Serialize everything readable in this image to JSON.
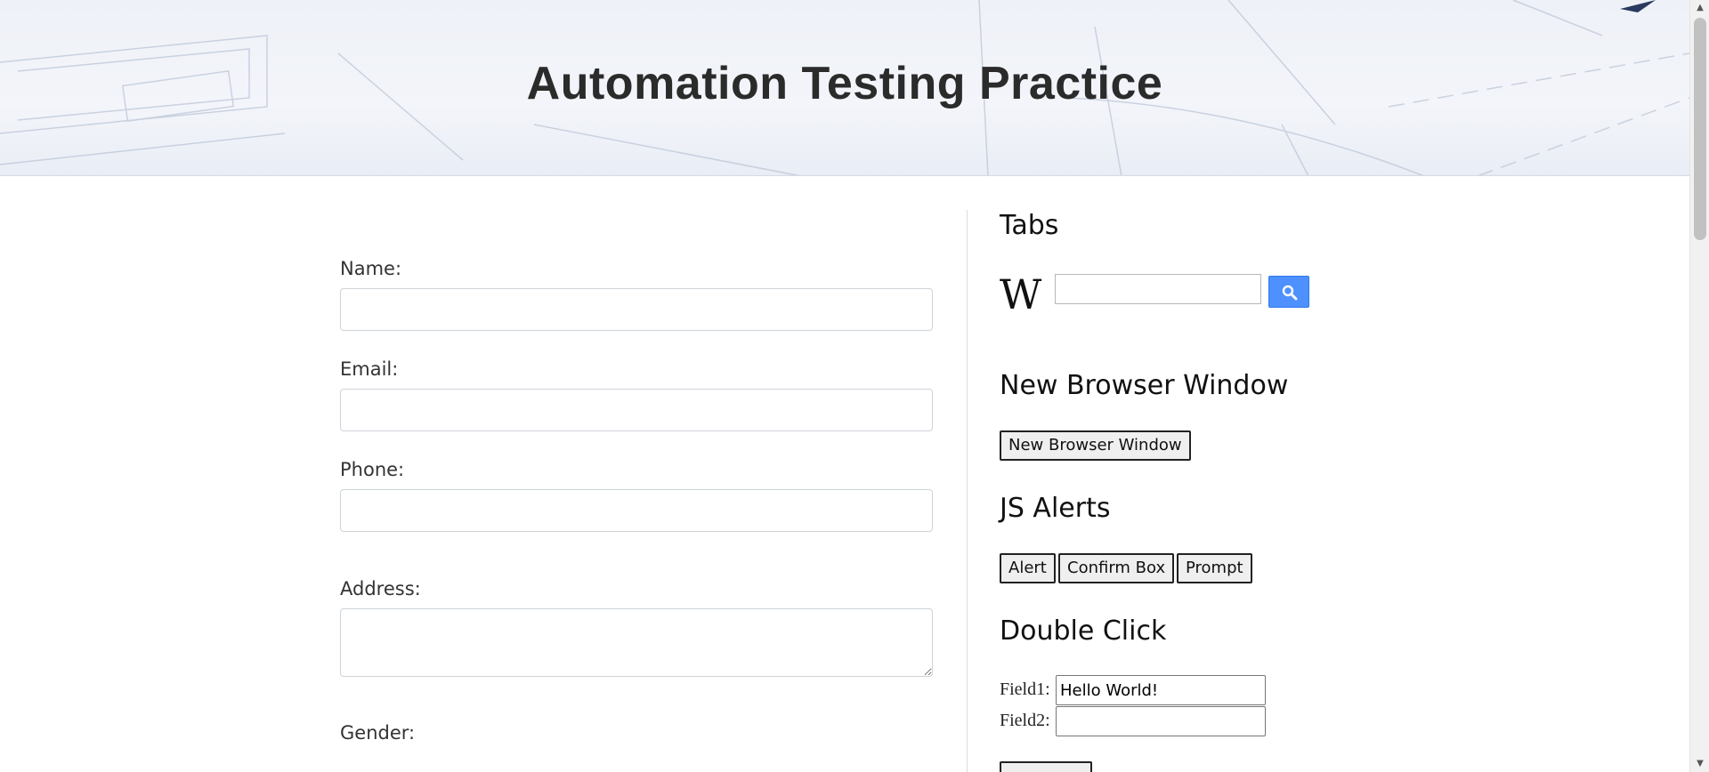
{
  "header": {
    "title": "Automation Testing Practice"
  },
  "form": {
    "name_label": "Name:",
    "name_value": "",
    "email_label": "Email:",
    "email_value": "",
    "phone_label": "Phone:",
    "phone_value": "",
    "address_label": "Address:",
    "address_value": "",
    "gender_label": "Gender:"
  },
  "tabs": {
    "title": "Tabs",
    "wiki_logo": "W",
    "search_value": "",
    "search_icon": "magnifier-icon"
  },
  "new_window": {
    "title": "New Browser Window",
    "button_label": "New Browser Window"
  },
  "alerts": {
    "title": "JS Alerts",
    "alert_label": "Alert",
    "confirm_label": "Confirm Box",
    "prompt_label": "Prompt"
  },
  "double_click": {
    "title": "Double Click",
    "field1_label": "Field1:",
    "field1_value": "Hello World!",
    "field2_label": "Field2:",
    "field2_value": ""
  },
  "colors": {
    "search_button": "#4d90fe",
    "title_text": "#2b2b2b"
  }
}
